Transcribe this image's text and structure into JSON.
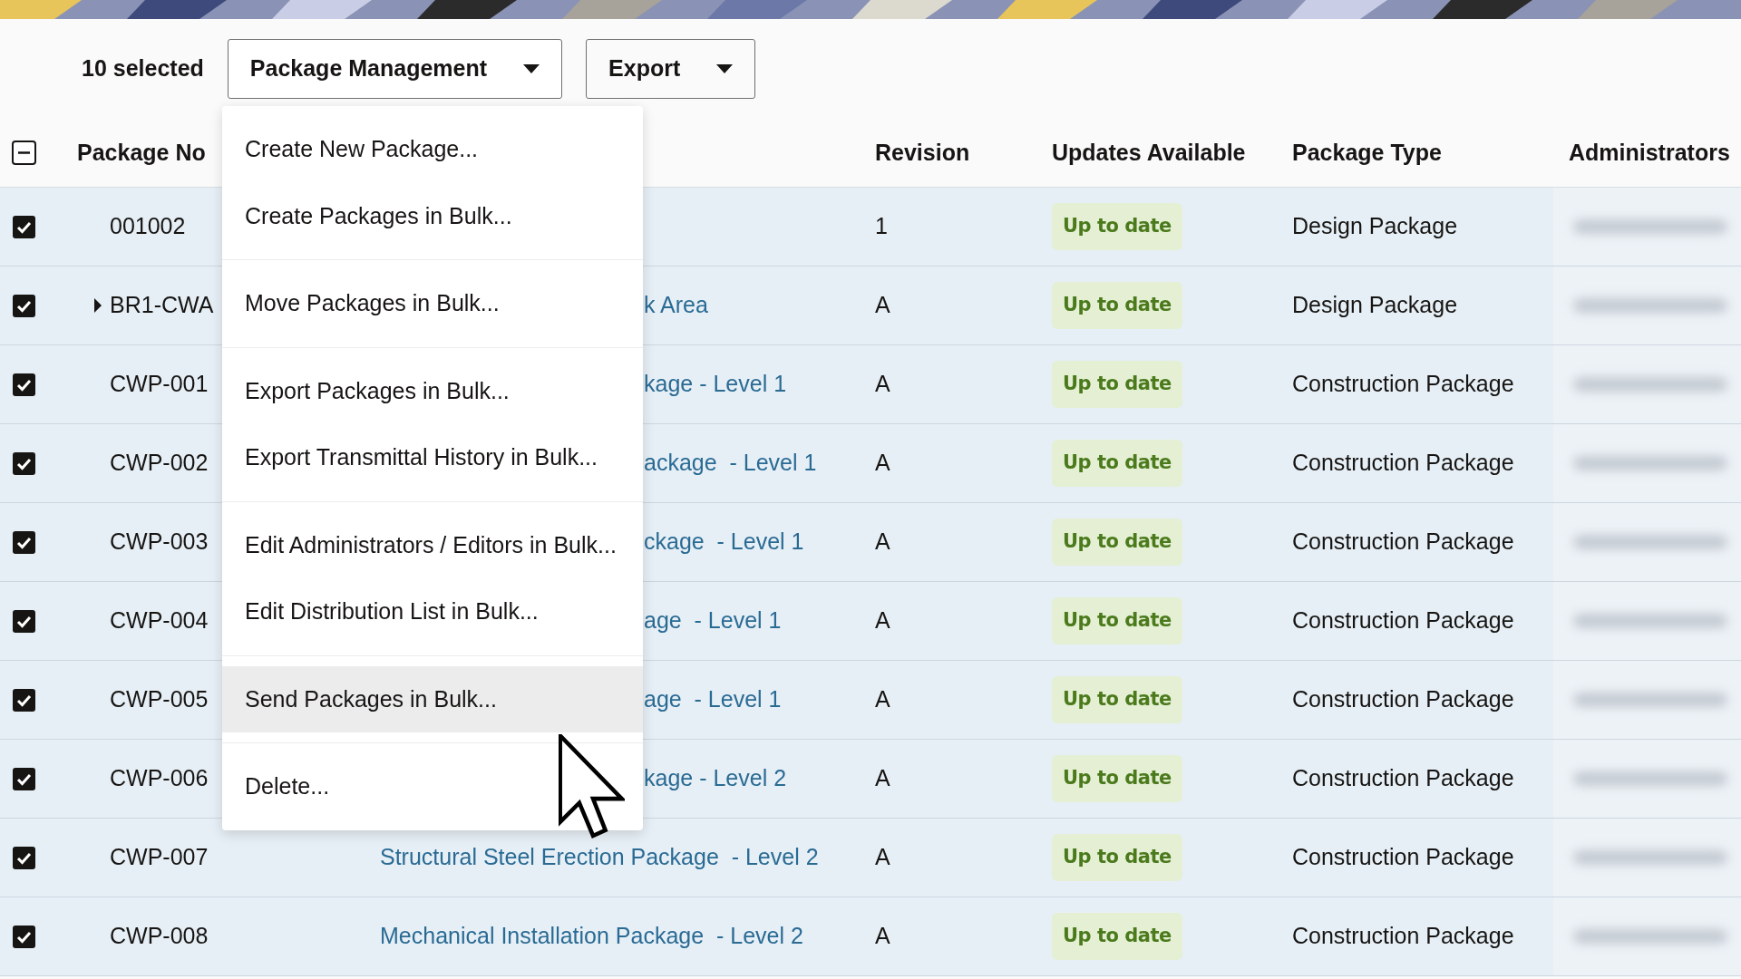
{
  "toolbar": {
    "selected_count": "10 selected",
    "buttons": [
      {
        "label": "Package Management",
        "menu": {
          "groups": [
            [
              {
                "label": "Create New Package...",
                "hovered": false
              },
              {
                "label": "Create Packages in Bulk...",
                "hovered": false
              }
            ],
            [
              {
                "label": "Move Packages in Bulk...",
                "hovered": false
              }
            ],
            [
              {
                "label": "Export Packages in Bulk...",
                "hovered": false
              },
              {
                "label": "Export Transmittal History in Bulk...",
                "hovered": false
              }
            ],
            [
              {
                "label": "Edit Administrators / Editors in Bulk...",
                "hovered": false
              },
              {
                "label": "Edit Distribution List in Bulk...",
                "hovered": false
              }
            ],
            [
              {
                "label": "Send Packages in Bulk...",
                "hovered": true
              }
            ],
            [
              {
                "label": "Delete...",
                "hovered": false
              }
            ]
          ]
        }
      },
      {
        "label": "Export"
      }
    ]
  },
  "table": {
    "header_checkbox": {
      "indeterminate": true
    },
    "columns": [
      "Package No",
      "Revision",
      "Updates Available",
      "Package Type",
      "Administrators"
    ],
    "rows": [
      {
        "kind": "package",
        "checked": true,
        "package_no": "001002",
        "revision": "1",
        "updates": "Up to date",
        "type": "Design Package"
      },
      {
        "kind": "group",
        "expanded": false,
        "checked": true,
        "package_no": "BR1-CWA",
        "name": "k Area",
        "revision": "A",
        "updates": "Up to date",
        "type": "Design Package"
      },
      {
        "kind": "package",
        "checked": true,
        "package_no": "CWP-001",
        "name": "kage - Level 1",
        "revision": "A",
        "updates": "Up to date",
        "type": "Construction Package"
      },
      {
        "kind": "package",
        "checked": true,
        "package_no": "CWP-002",
        "name": "ackage  - Level 1",
        "revision": "A",
        "updates": "Up to date",
        "type": "Construction Package"
      },
      {
        "kind": "package",
        "checked": true,
        "package_no": "CWP-003",
        "name": "ckage  - Level 1",
        "revision": "A",
        "updates": "Up to date",
        "type": "Construction Package"
      },
      {
        "kind": "package",
        "checked": true,
        "package_no": "CWP-004",
        "name": "age  - Level 1",
        "revision": "A",
        "updates": "Up to date",
        "type": "Construction Package"
      },
      {
        "kind": "package",
        "checked": true,
        "package_no": "CWP-005",
        "name": "age  - Level 1",
        "revision": "A",
        "updates": "Up to date",
        "type": "Construction Package"
      },
      {
        "kind": "package",
        "checked": true,
        "package_no": "CWP-006",
        "name": "kage - Level 2",
        "revision": "A",
        "updates": "Up to date",
        "type": "Construction Package"
      },
      {
        "kind": "package",
        "checked": true,
        "package_no": "CWP-007",
        "name": "Structural Steel Erection Package  - Level 2",
        "revision": "A",
        "updates": "Up to date",
        "type": "Construction Package"
      },
      {
        "kind": "package",
        "checked": true,
        "package_no": "CWP-008",
        "name": "Mechanical Installation Package  - Level 2",
        "revision": "A",
        "updates": "Up to date",
        "type": "Construction Package"
      }
    ]
  }
}
